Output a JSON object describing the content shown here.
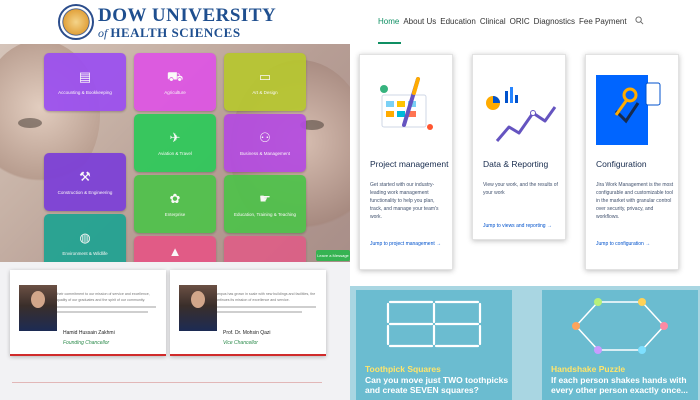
{
  "duhs": {
    "name_line1": "DOW UNIVERSITY",
    "name_line2_of": "of",
    "name_line2": "HEALTH SCIENCES",
    "tiles": [
      {
        "label": "Accounting & Bookkeeping",
        "icon": "file-icon"
      },
      {
        "label": "Agriculture",
        "icon": "tractor-icon"
      },
      {
        "label": "Art & Design",
        "icon": "monitor-icon"
      },
      {
        "label": "Aviation & Travel",
        "icon": "plane-icon"
      },
      {
        "label": "Business & Management",
        "icon": "people-icon"
      },
      {
        "label": "Construction & Engineering",
        "icon": "crane-icon"
      },
      {
        "label": "Enterprise",
        "icon": "puzzle-icon"
      },
      {
        "label": "Education, Training & Teaching",
        "icon": "hand-icon"
      },
      {
        "label": "Environment & Wildlife",
        "icon": "globe-icon"
      }
    ],
    "chat_label": "Leave a Message",
    "leaders": [
      {
        "quote": "We honour their commitment to our mission of service and excellence, pride in the quality of our graduates and the spirit of our community.",
        "name": "Hamid Hussain Zakhmi",
        "role": "Founding Chancellor"
      },
      {
        "quote": "While the campus has grown in scale with new buildings and facilities, the university continues its mission of excellence and service.",
        "name": "Prof. Dr. Mohsin Qazi",
        "role": "Vice Chancellor"
      }
    ]
  },
  "nav": {
    "items": [
      "Home",
      "About Us",
      "Education",
      "Clinical",
      "ORIC",
      "Diagnostics",
      "Fee Payment"
    ]
  },
  "cards": [
    {
      "title": "Project management",
      "desc": "Get started with our industry-leading work management functionality to help you plan, track, and manage your team's work.",
      "link": "Jump to project management →"
    },
    {
      "title": "Data & Reporting",
      "desc": "View your work, and the results of your work",
      "link": "Jump to views and reporting →"
    },
    {
      "title": "Configuration",
      "desc": "Jira Work Management is the most configurable and customizable tool in the market with granular control over security, privacy, and workflows.",
      "link": "Jump to configuration →"
    }
  ],
  "puzzles": [
    {
      "title": "Toothpick Squares",
      "desc": "Can you move just TWO toothpicks and create SEVEN squares?"
    },
    {
      "title": "Handshake Puzzle",
      "desc": "If each person shakes hands with every other person exactly once..."
    }
  ]
}
